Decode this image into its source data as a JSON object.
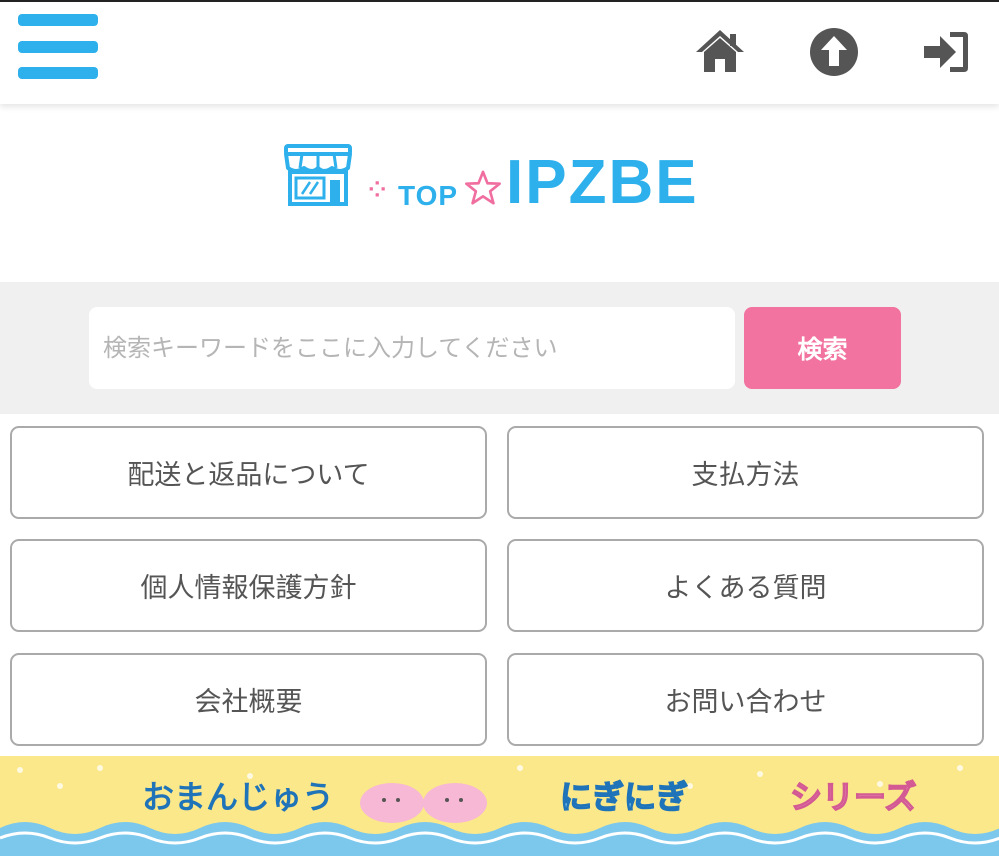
{
  "header": {
    "menu_icon": "hamburger-menu-icon",
    "menu_color": "#2db0ec",
    "actions": [
      {
        "icon": "home-icon"
      },
      {
        "icon": "arrow-up-circle-icon"
      },
      {
        "icon": "sign-in-icon"
      }
    ]
  },
  "logo": {
    "icon": "shop-storefront-icon",
    "sparkle": "⁘",
    "top_text": "TOP",
    "star_icon": "star-outline-icon",
    "main_text": "IPZBE",
    "accent_color": "#2db0ec",
    "pink_color": "#f06fa0"
  },
  "search": {
    "placeholder": "検索キーワードをここに入力してください",
    "value": "",
    "button_label": "検索",
    "button_color": "#f2739f"
  },
  "nav": {
    "items": [
      {
        "label": "配送と返品について"
      },
      {
        "label": "支払方法"
      },
      {
        "label": "個人情報保護方針"
      },
      {
        "label": "よくある質問"
      },
      {
        "label": "会社概要"
      },
      {
        "label": "お問い合わせ"
      }
    ]
  },
  "banner": {
    "title_left": "おまんじゅう",
    "title_mid": "にぎにぎ",
    "title_right": "シリーズ",
    "bg_color": "#fbe88a",
    "wave_color": "#7cc8ec"
  }
}
